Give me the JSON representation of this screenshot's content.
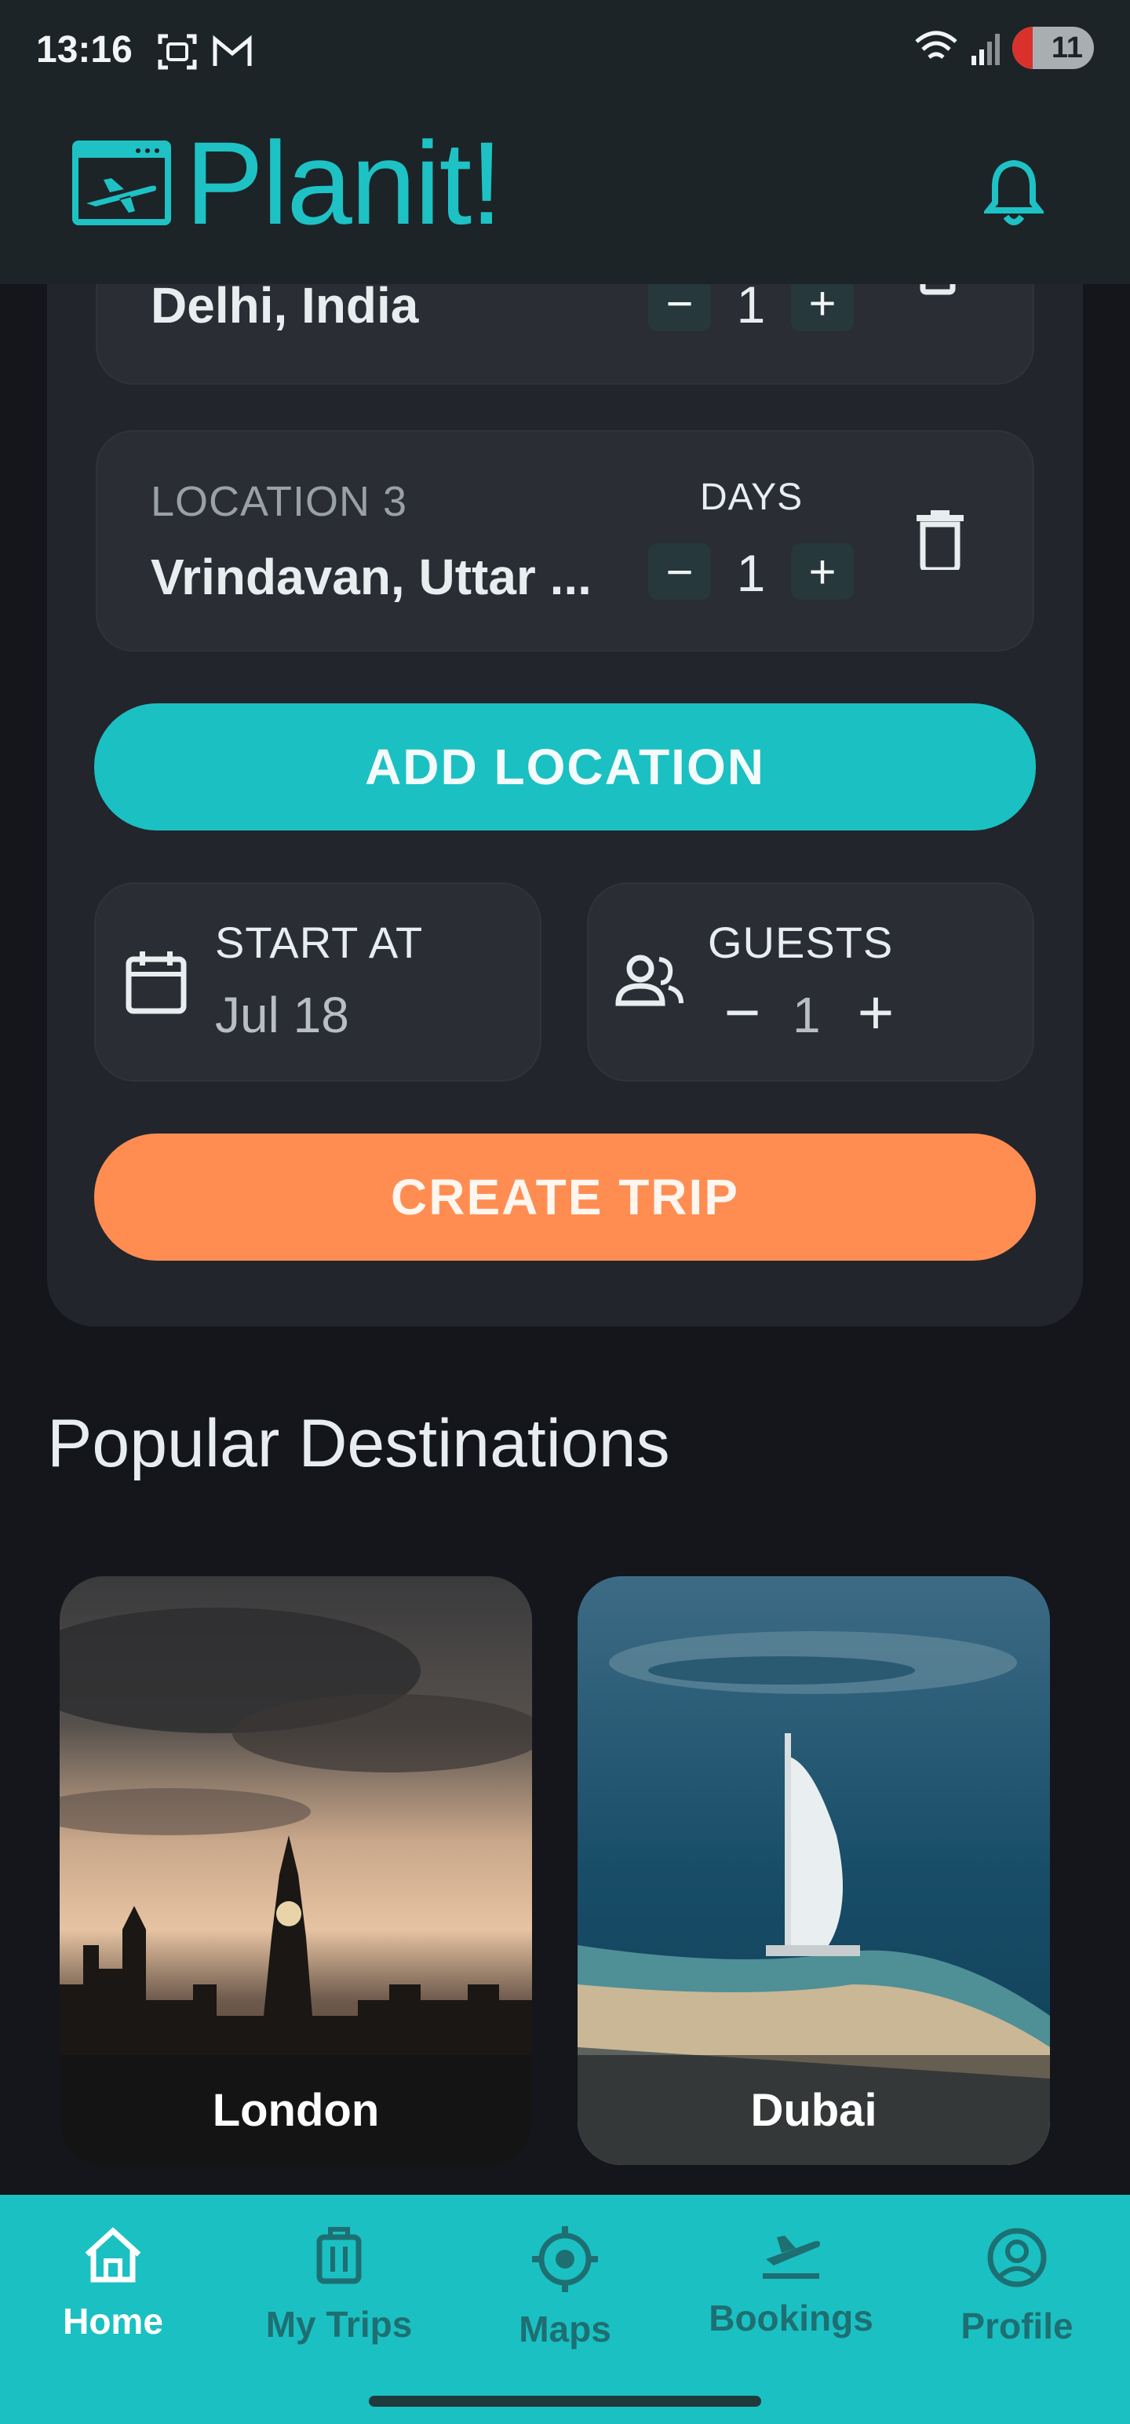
{
  "status_bar": {
    "time": "13:16",
    "battery": "11"
  },
  "app": {
    "name": "Planit!"
  },
  "trip_form": {
    "location2": {
      "value": "Delhi, India",
      "days": "1"
    },
    "location3": {
      "label": "LOCATION 3",
      "value": "Vrindavan, Uttar ...",
      "days_label": "DAYS",
      "days": "1"
    },
    "add_location_label": "ADD LOCATION",
    "start_at": {
      "label": "START AT",
      "value": "Jul 18"
    },
    "guests": {
      "label": "GUESTS",
      "value": "1"
    },
    "create_trip_label": "CREATE TRIP"
  },
  "popular": {
    "title": "Popular Destinations",
    "destinations": [
      {
        "name": "London"
      },
      {
        "name": "Dubai"
      }
    ]
  },
  "bottom_nav": {
    "items": [
      {
        "label": "Home",
        "icon": "home-icon",
        "active": true
      },
      {
        "label": "My Trips",
        "icon": "luggage-icon",
        "active": false
      },
      {
        "label": "Maps",
        "icon": "target-icon",
        "active": false
      },
      {
        "label": "Bookings",
        "icon": "flight-takeoff-icon",
        "active": false
      },
      {
        "label": "Profile",
        "icon": "profile-icon",
        "active": false
      }
    ]
  },
  "colors": {
    "accent": "#1bc0c2",
    "cta": "#ff8d52",
    "background": "#14161c"
  }
}
